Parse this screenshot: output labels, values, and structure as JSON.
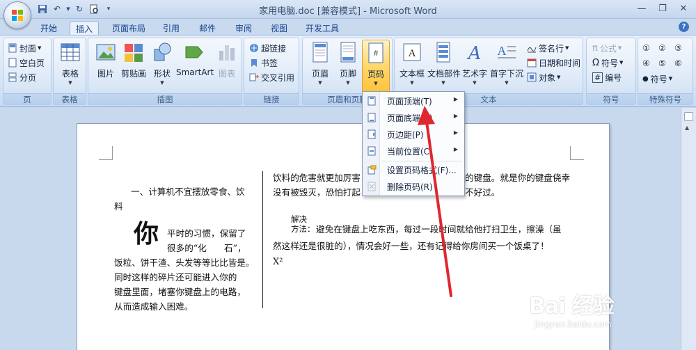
{
  "window": {
    "title": "家用电脑.doc [兼容模式] - Microsoft Word",
    "controls": [
      "minimize-icon",
      "restore-icon",
      "close-icon"
    ]
  },
  "quick_access": [
    "save-icon",
    "undo-icon",
    "redo-icon",
    "print-preview-icon",
    "customize-icon"
  ],
  "tabs": [
    "开始",
    "插入",
    "页面布局",
    "引用",
    "邮件",
    "审阅",
    "视图",
    "开发工具"
  ],
  "active_tab": "插入",
  "ribbon": {
    "pages": {
      "cover": "封面",
      "blank": "空白页",
      "break": "分页",
      "label": "页"
    },
    "tables": {
      "table": "表格",
      "label": "表格"
    },
    "illustrations": {
      "picture": "图片",
      "clipart": "剪贴画",
      "shapes": "形状",
      "smartart": "SmartArt",
      "chart": "图表",
      "label": "插图"
    },
    "links": {
      "hyperlink": "超链接",
      "bookmark": "书签",
      "crossref": "交叉引用",
      "label": "链接"
    },
    "header_footer": {
      "header": "页眉",
      "footer": "页脚",
      "pagenum": "页码",
      "label": "页眉和页脚"
    },
    "text": {
      "textbox": "文本框",
      "quickparts": "文档部件",
      "wordart": "艺术字",
      "dropcap": "首字下沉",
      "signature": "签名行",
      "datetime": "日期和时间",
      "object": "对象",
      "label": "文本"
    },
    "symbols": {
      "equation": "公式",
      "symbol": "符号",
      "number": "编号",
      "label": "符号"
    },
    "special": {
      "chars": [
        "①",
        "②",
        "③",
        "④",
        "⑤",
        "⑥"
      ],
      "symbol": "符号",
      "label": "特殊符号"
    }
  },
  "menu": {
    "items": [
      "页面顶端(T)",
      "页面底端(B)",
      "页边距(P)",
      "当前位置(C)",
      "设置页码格式(F)...",
      "删除页码(R)"
    ]
  },
  "document": {
    "left_heading_line1": "一、计算机不宜摆放零食、饮",
    "left_heading_line2": "料",
    "dropcap": "你",
    "left_para": [
      "平时的习惯，保留了",
      "很多的“化　　石”，",
      "饭粒、饼干渣、头发等等比比皆是。",
      "同时这样的碎片还可能进入你的",
      "键盘里面，堵塞你键盘上的电路，",
      "从而造成输入困难。"
    ],
    "right_top": [
      "饮料的危害就更加厉害",
      "的键盘。就是你的键盘侥幸",
      "没有被毁灭，恐怕打起",
      "不好过。"
    ],
    "solution_word": "解决",
    "solution_label": "方法：",
    "solution_text1": "避免在键盘上吃东西，每过一段时间就给他打扫卫生，擦澡（虽",
    "solution_text2": "然这样还是很脏的），情况会好一些，还有记得给你房间买一个饭桌了！",
    "x2": "X²"
  },
  "watermark": {
    "brand": "Bai 经验",
    "url": "jingyan.baidu.com"
  },
  "colors": {
    "accent": "#2b579a",
    "arrow": "#e0262f",
    "highlight": "#ffd86c"
  }
}
